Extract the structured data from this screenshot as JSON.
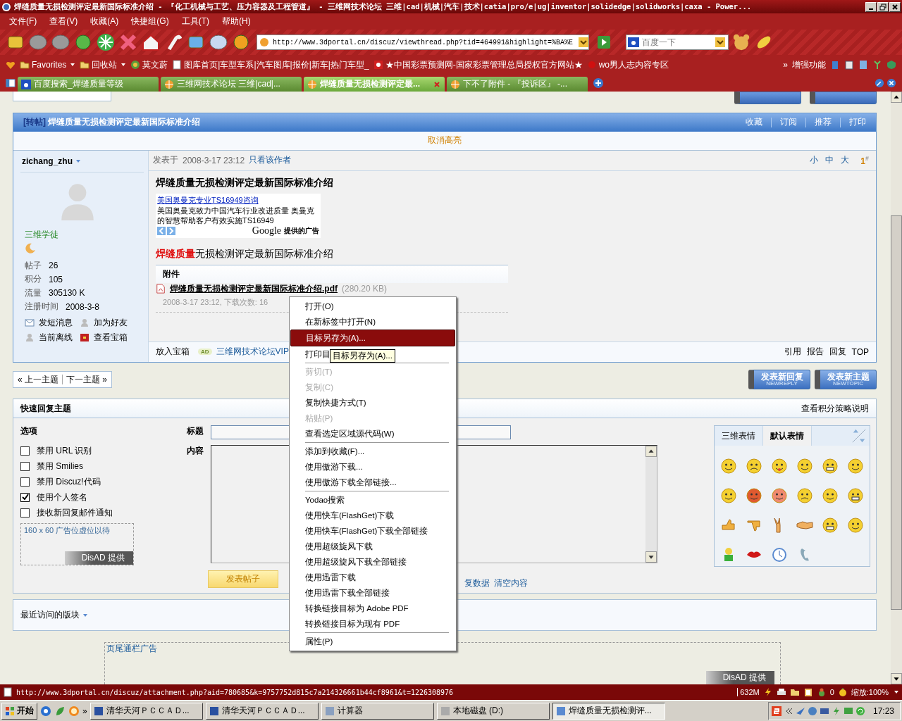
{
  "window": {
    "title": "焊缝质量无损检测评定最新国际标准介绍 - 『化工机械与工艺、压力容器及工程管道』 - 三维网技术论坛 三维|cad|机械|汽车|技术|catia|pro/e|ug|inventor|solidedge|solidworks|caxa - Power..."
  },
  "menu_bar": [
    "文件(F)",
    "查看(V)",
    "收藏(A)",
    "快捷组(G)",
    "工具(T)",
    "帮助(H)"
  ],
  "address": {
    "value": "http://www.3dportal.cn/discuz/viewthread.php?tid=464991&highlight=%BA%E"
  },
  "search": {
    "placeholder": "百度一下"
  },
  "links_bar": [
    {
      "label": "Favorites",
      "kind": "folder"
    },
    {
      "label": "回收站",
      "kind": "folder"
    },
    {
      "label": "莫文蔚",
      "kind": "globe"
    },
    {
      "label": "图库首页|车型车系|汽车图库|报价|新车|热门车型_",
      "kind": "page"
    },
    {
      "label": "★中国彩票预测网-国家彩票管理总局授权官方网站★",
      "kind": "lottery"
    },
    {
      "label": "wo男人志内容专区",
      "kind": "dot"
    }
  ],
  "links_more": "»",
  "enhance": "增强功能",
  "tabs": [
    {
      "label": "百度搜索_焊缝质量等级",
      "selected": false
    },
    {
      "label": "三维网技术论坛 三维|cad|...",
      "selected": false
    },
    {
      "label": "焊缝质量无损检测评定最...",
      "selected": true
    },
    {
      "label": "下不了附件 - 『投诉区』 -...",
      "selected": false
    }
  ],
  "post": {
    "tag": "[转帖]",
    "title": "焊缝质量无损检测评定最新国际标准介绍",
    "actions": [
      "收藏",
      "订阅",
      "推荐",
      "打印"
    ],
    "highlight_off": "取消高亮",
    "author": {
      "name": "zichang_zhu",
      "rank": "三维学徒",
      "stats": [
        {
          "label": "帖子",
          "value": "26"
        },
        {
          "label": "积分",
          "value": "105"
        },
        {
          "label": "流量",
          "value": "305130 K"
        },
        {
          "label": "注册时间",
          "value": "2008-3-8"
        }
      ],
      "actions": [
        "发短消息",
        "加为好友",
        "当前离线",
        "查看宝箱"
      ]
    },
    "posted": "发表于",
    "time": "2008-3-17 23:12",
    "author_only": "只看该作者",
    "sizes": [
      "小",
      "中",
      "大"
    ],
    "floor": "1$^{#}$",
    "heading": "焊缝质量无损检测评定最新国际标准介绍",
    "ad": {
      "link": "美国奥曼克专业TS16949咨询",
      "text": "美国奥曼克致力中国汽车行业改进质量 奥曼克的智慧帮助客户有效实施TS16949",
      "brand": "Google",
      "by": "提供的广告"
    },
    "body": "**焊缝质量**无损检测评定最新国际标准介绍",
    "attachments": {
      "title": "附件",
      "file": "焊缝质量无损检测评定最新国际标准介绍.pdf",
      "size": "(280.20 KB)",
      "info": "2008-3-17 23:12, 下载次数: 16"
    },
    "treasure": "放入宝箱",
    "ad_badge": "AD",
    "ad_link": "三维网技术论坛VIP",
    "footer_actions": [
      "引用",
      "报告",
      "回复",
      "TOP"
    ]
  },
  "thread_nav": {
    "prev": "« 上一主题",
    "next": "下一主题 »"
  },
  "new_buttons": [
    {
      "label": "发表新回复",
      "sub": "NEWREPLY"
    },
    {
      "label": "发表新主题",
      "sub": "NEWTOPIC"
    }
  ],
  "quick_reply": {
    "title": "快速回复主题",
    "policy_link": "查看积分策略说明",
    "options_title": "选项",
    "options": [
      {
        "label": "禁用 URL 识别",
        "checked": false
      },
      {
        "label": "禁用 Smilies",
        "checked": false
      },
      {
        "label": "禁用 Discuz!代码",
        "checked": false
      },
      {
        "label": "使用个人签名",
        "checked": true
      },
      {
        "label": "接收新回复邮件通知",
        "checked": false
      }
    ],
    "ad_slot": {
      "text": "160 x 60 广告位虚位以待",
      "by": "DisAD 提供"
    },
    "subject_label": "标题",
    "content_label": "内容",
    "submit": "发表帖子",
    "links": [
      "复数据",
      "清空内容"
    ],
    "smiley_tabs": [
      {
        "label": "三维表情",
        "selected": false
      },
      {
        "label": "默认表情",
        "selected": true
      }
    ]
  },
  "recent": {
    "label": "最近访问的版块"
  },
  "footer_ad": {
    "label": "页尾通栏广告",
    "by": "DisAD 提供"
  },
  "context_menu": [
    {
      "kind": "item",
      "label": "打开(O)",
      "disabled": false,
      "selected": false
    },
    {
      "kind": "item",
      "label": "在新标签中打开(N)",
      "disabled": false,
      "selected": false
    },
    {
      "kind": "item",
      "label": "目标另存为(A)...",
      "disabled": false,
      "selected": true
    },
    {
      "kind": "item",
      "label": "打印目",
      "disabled": false,
      "selected": false
    },
    {
      "kind": "separator"
    },
    {
      "kind": "item",
      "label": "剪切(T)",
      "disabled": true,
      "selected": false
    },
    {
      "kind": "item",
      "label": "复制(C)",
      "disabled": true,
      "selected": false
    },
    {
      "kind": "item",
      "label": "复制快捷方式(T)",
      "disabled": false,
      "selected": false
    },
    {
      "kind": "item",
      "label": "粘贴(P)",
      "disabled": true,
      "selected": false
    },
    {
      "kind": "item",
      "label": "查看选定区域源代码(W)",
      "disabled": false,
      "selected": false
    },
    {
      "kind": "separator"
    },
    {
      "kind": "item",
      "label": "添加到收藏(F)...",
      "disabled": false,
      "selected": false
    },
    {
      "kind": "item",
      "label": "使用傲游下载...",
      "disabled": false,
      "selected": false
    },
    {
      "kind": "item",
      "label": "使用傲游下载全部链接...",
      "disabled": false,
      "selected": false
    },
    {
      "kind": "separator"
    },
    {
      "kind": "item",
      "label": "Yodao搜索",
      "disabled": false,
      "selected": false
    },
    {
      "kind": "item",
      "label": "使用快车(FlashGet)下载",
      "disabled": false,
      "selected": false
    },
    {
      "kind": "item",
      "label": "使用快车(FlashGet)下载全部链接",
      "disabled": false,
      "selected": false
    },
    {
      "kind": "item",
      "label": "使用超级旋风下载",
      "disabled": false,
      "selected": false
    },
    {
      "kind": "item",
      "label": "使用超级旋风下载全部链接",
      "disabled": false,
      "selected": false
    },
    {
      "kind": "item",
      "label": "使用迅雷下载",
      "disabled": false,
      "selected": false
    },
    {
      "kind": "item",
      "label": "使用迅雷下载全部链接",
      "disabled": false,
      "selected": false
    },
    {
      "kind": "item",
      "label": "转换链接目标为 Adobe PDF",
      "disabled": false,
      "selected": false
    },
    {
      "kind": "item",
      "label": "转换链接目标为现有 PDF",
      "disabled": false,
      "selected": false
    },
    {
      "kind": "separator"
    },
    {
      "kind": "item",
      "label": "属性(P)",
      "disabled": false,
      "selected": false
    }
  ],
  "tooltip": "目标另存为(A)...",
  "status_bar": {
    "url": "http://www.3dportal.cn/discuz/attachment.php?aid=780685&k=9757752d815c7a214326661b44cf8961&t=1226308976",
    "memory": "632M",
    "count": "0",
    "zoom": "缩放:100%"
  },
  "taskbar": {
    "start": "开始",
    "more": "»",
    "tasks": [
      {
        "label": "清华天河ＰＣＣＡＤ...",
        "selected": false
      },
      {
        "label": "清华天河ＰＣＣＡＤ...",
        "selected": false
      },
      {
        "label": "计算器",
        "selected": false
      },
      {
        "label": "本地磁盘 (D:)",
        "selected": false
      },
      {
        "label": "焊缝质量无损检测评...",
        "selected": true
      }
    ],
    "clock": "17:23"
  }
}
